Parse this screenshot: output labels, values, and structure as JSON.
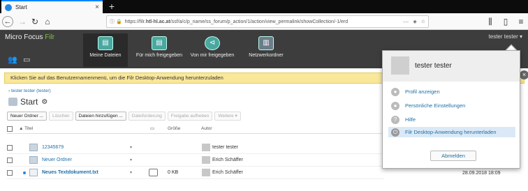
{
  "browser": {
    "tab_title": "Start",
    "new_tab_glyph": "+",
    "url_prefix": "https://filr.",
    "url_domain": "htl-hl.ac.at",
    "url_rest": "/ssf/a/c/p_name/ss_forum/p_action/1/action/view_permalink/showCollection/-1/erd",
    "url_more": "···"
  },
  "app": {
    "brand_a": "Micro Focus",
    "brand_b": "Filr",
    "user_menu": "tester tester ▾",
    "nav": [
      {
        "label": "Meine Dateien",
        "icon": "my-files-icon"
      },
      {
        "label": "Für mich freigegeben",
        "icon": "shared-with-me-icon"
      },
      {
        "label": "Von mir freigegeben",
        "icon": "shared-by-me-icon"
      },
      {
        "label": "Netzwerkordner",
        "icon": "net-folders-icon"
      }
    ]
  },
  "infobar": {
    "text": "Klicken Sie auf das Benutzernamenmenü, um die Filr Desktop-Anwendung herunterzuladen"
  },
  "breadcrumb": "› tester tester (tester)",
  "page_title": "Start",
  "toolbar": [
    "Neuer Ordner ...",
    "Löschen",
    "Dateien hinzufügen ...",
    "Dateiforderung",
    "Freigabe aufheben",
    "Weitere ▾"
  ],
  "table": {
    "headers": {
      "title": "▲ Titel",
      "size": "Größe",
      "author": "Autor"
    },
    "rows": [
      {
        "name": "12345679",
        "size": "",
        "author": "tester tester"
      },
      {
        "name": "Neuer Ordner",
        "size": "",
        "author": "Erich Schäffer"
      },
      {
        "name": "Neues Textdokument.txt",
        "size": "0 KB",
        "author": "Erich Schäffer"
      }
    ],
    "last_date": "28.09.2018 18:09"
  },
  "dropdown": {
    "name": "tester tester",
    "items": [
      "Profil anzeigen",
      "Persönliche Einstellungen",
      "Hilfe",
      "Filr Desktop-Anwendung herunterladen"
    ],
    "logout": "Abmelden"
  },
  "colors": {
    "accent": "#1d6fa5",
    "header": "#3d3d3d",
    "info": "#f9e79a"
  }
}
